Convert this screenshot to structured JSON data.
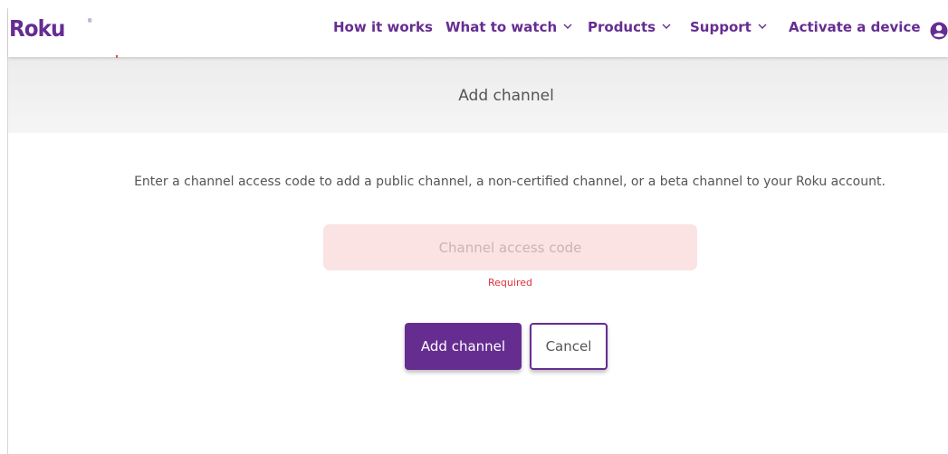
{
  "header": {
    "logo_text": "Roku",
    "logo_mark": "®",
    "nav": {
      "how_it_works": "How it works",
      "what_to_watch": "What to watch",
      "products": "Products",
      "support": "Support",
      "activate": "Activate a device"
    },
    "account_icon": "user-account-icon"
  },
  "band": {
    "title": "Add channel"
  },
  "form": {
    "description": "Enter a channel access code to add a public channel, a non-certified channel, or a beta channel to your Roku account.",
    "code_placeholder": "Channel access code",
    "code_value": "",
    "error_text": "Required",
    "add_button": "Add channel",
    "cancel_button": "Cancel"
  },
  "colors": {
    "brand_purple": "#662d91",
    "error_red": "#e0313b",
    "input_error_bg": "#fbe3e3",
    "band_bg": "#efefef"
  }
}
